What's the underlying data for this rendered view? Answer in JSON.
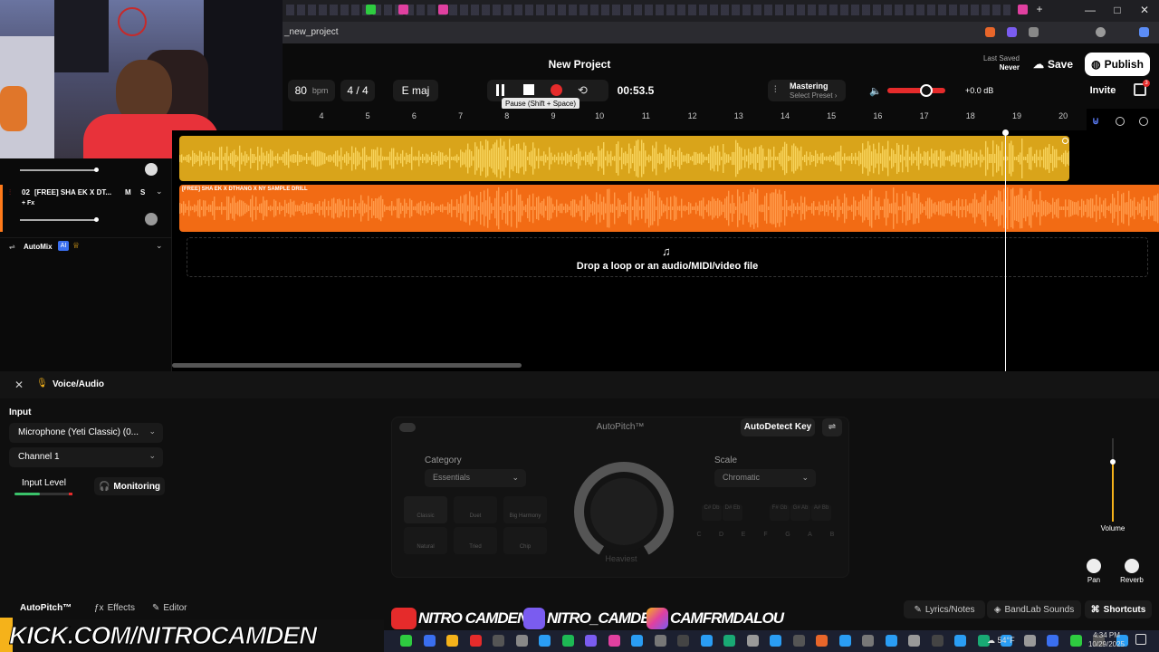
{
  "browser": {
    "url": "_new_project",
    "window_controls": [
      "—",
      "□",
      "✕"
    ]
  },
  "header": {
    "project_title": "New Project",
    "tempo": "80",
    "tempo_unit": "bpm",
    "time_signature": "4 / 4",
    "key": "E maj",
    "time": "00:53.5",
    "tooltip": "Pause (Shift + Space)",
    "mastering": "Mastering",
    "select_preset": "Select Preset",
    "volume_db": "+0.0 dB",
    "last_saved_label": "Last Saved",
    "last_saved_value": "Never",
    "save": "Save",
    "publish": "Publish",
    "invite": "Invite",
    "cart_count": "3"
  },
  "ruler": [
    "4",
    "5",
    "6",
    "7",
    "8",
    "9",
    "10",
    "11",
    "12",
    "13",
    "14",
    "15",
    "16",
    "17",
    "18",
    "19",
    "20"
  ],
  "tracks": [
    {
      "number": "02",
      "name": "[FREE] SHA EK X DT...",
      "mute": "M",
      "solo": "S",
      "fx": "+ Fx",
      "clip_name": "[FREE] SHA EK X DTHANG X NY SAMPLE DRILL"
    }
  ],
  "automix": {
    "label": "AutoMix",
    "badge": "AI"
  },
  "dropzone": "Drop a loop or an audio/MIDI/video file",
  "panel": {
    "title": "Voice/Audio",
    "input_label": "Input",
    "device": "Microphone (Yeti Classic) (0...",
    "channel": "Channel 1",
    "input_level": "Input Level",
    "monitoring": "Monitoring",
    "autopitch_title": "AutoPitch™",
    "autodetect": "AutoDetect Key",
    "category_label": "Category",
    "category_value": "Essentials",
    "scale_label": "Scale",
    "scale_value": "Chromatic",
    "styles": [
      "Classic",
      "Duet",
      "Big Harmony",
      "Natural",
      "Tried",
      "Chip"
    ],
    "dial_label": "Heaviest",
    "note_keys": [
      "C",
      "D",
      "E",
      "F",
      "G",
      "A",
      "B"
    ],
    "sharps": [
      "C#\nDb",
      "D#\nEb",
      "F#\nGb",
      "G#\nAb",
      "A#\nBb"
    ],
    "volume": "Volume",
    "pan": "Pan",
    "reverb": "Reverb"
  },
  "bottom_tabs": {
    "autopitch": "AutoPitch™",
    "effects": "Effects",
    "editor": "Editor",
    "lyrics": "Lyrics/Notes",
    "bandlab": "BandLab Sounds",
    "shortcuts": "Shortcuts"
  },
  "overlay": {
    "kick": "KICK.COM/NITROCAMDEN",
    "youtube": "NITRO CAMDEN",
    "twitch": "NITRO_CAMDEN",
    "instagram": "CAMFRMDALOU"
  },
  "taskbar": {
    "weather": "54°F",
    "time": "4:34 PM",
    "date": "10/29/2025"
  },
  "colors": {
    "clip1": "#d9a41a",
    "clip2": "#f26b14",
    "record": "#e52b2b",
    "accent": "#f5b21a"
  }
}
